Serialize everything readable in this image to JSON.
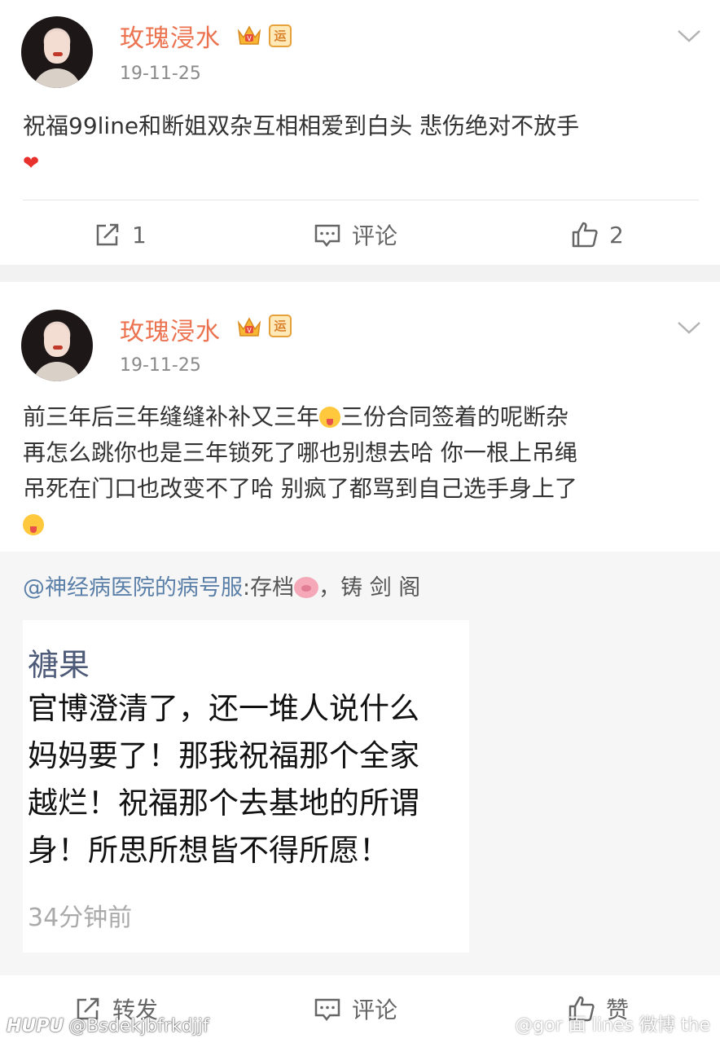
{
  "posts": [
    {
      "username": "玫瑰浸水",
      "badge": "运",
      "date": "19-11-25",
      "text": "祝福99line和断姐双杂互相相爱到白头 悲伤绝对不放手",
      "heart": "❤",
      "actions": {
        "repost": "1",
        "comment": "评论",
        "like": "2"
      }
    },
    {
      "username": "玫瑰浸水",
      "badge": "运",
      "date": "19-11-25",
      "text_a": "前三年后三年缝缝补补又三年",
      "text_b": "三份合同签着的呢断杂",
      "text_c": "再怎么跳你也是三年锁死了哪也别想去哈 你一根上吊绳",
      "text_d": "吊死在门口也改变不了哈 别疯了都骂到自己选手身上了",
      "repost": {
        "mention": "@神经病医院的病号服",
        "text": ":存档",
        "suffix": "，铸 剑 阁",
        "screenshot": {
          "name": "禟果",
          "lines": [
            "官博澄清了，还一堆人说什么",
            "妈妈要了！那我祝福那个全家",
            "越烂！祝福那个去基地的所谓",
            "身！所思所想皆不得所愿！"
          ],
          "time": "34分钟前"
        }
      },
      "actions": {
        "repost": "转发",
        "comment": "评论",
        "like": "赞"
      }
    }
  ],
  "watermarks": {
    "site": "HUPU",
    "user": "@Bsdekjbfrkdjjf",
    "right": "@gor 面 lines 微博 the"
  },
  "colors": {
    "username": "#eb7350",
    "mention": "#5a7fa8",
    "separator": "#f2f2f2"
  }
}
